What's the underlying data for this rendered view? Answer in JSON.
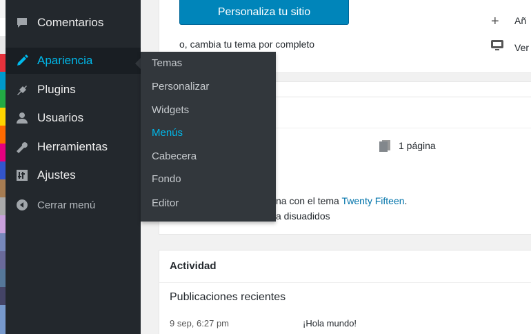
{
  "sidebar": {
    "items": [
      {
        "label": "Comentarios",
        "icon": "comment-icon"
      },
      {
        "label": "Apariencia",
        "icon": "brush-icon",
        "active": true
      },
      {
        "label": "Plugins",
        "icon": "plugin-icon"
      },
      {
        "label": "Usuarios",
        "icon": "users-icon"
      },
      {
        "label": "Herramientas",
        "icon": "wrench-icon"
      },
      {
        "label": "Ajustes",
        "icon": "settings-icon"
      },
      {
        "label": "Cerrar menú",
        "icon": "collapse-icon"
      }
    ]
  },
  "flyout": {
    "items": [
      "Temas",
      "Personalizar",
      "Widgets",
      "Menús",
      "Cabecera",
      "Fondo",
      "Editor"
    ],
    "current": "Menús"
  },
  "welcome": {
    "customize_button": "Personaliza tu sitio",
    "change_theme_link": "o, cambia tu tema por completo",
    "right_action_1": "Añ",
    "right_action_2": "Ver"
  },
  "glance": {
    "pages": "1 página",
    "theme_text_prefix": "na con el tema ",
    "theme_link": "Twenty Fifteen",
    "theme_text_suffix": ".",
    "discouraged_link": "a disuadidos"
  },
  "activity": {
    "title": "Actividad",
    "recent_heading": "Publicaciones recientes",
    "date": "9 sep, 6:27 pm",
    "post_link": "¡Hola mundo!"
  },
  "colors": {
    "sidebar_bg": "#23282d",
    "flyout_bg": "#32373c",
    "accent": "#00b9eb",
    "link": "#0073aa",
    "button": "#0085ba",
    "strip": [
      "#f5f5f5",
      "#ffffff",
      "#e8e8e8",
      "#e5323c",
      "#0099cc",
      "#22aa44",
      "#ffd400",
      "#ff6a00",
      "#e6007e",
      "#3355cc",
      "#a67c52",
      "#aaaaaa",
      "#c9a0dc",
      "#7788bb",
      "#6a6a9a",
      "#557799",
      "#444466",
      "#7799cc"
    ]
  }
}
